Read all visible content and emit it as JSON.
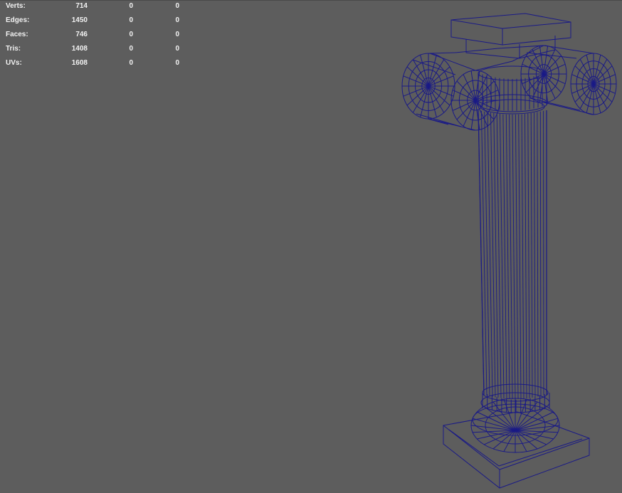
{
  "hud": {
    "rows": [
      {
        "label": "Verts:",
        "values": [
          "714",
          "0",
          "0"
        ]
      },
      {
        "label": "Edges:",
        "values": [
          "1450",
          "0",
          "0"
        ]
      },
      {
        "label": "Faces:",
        "values": [
          "746",
          "0",
          "0"
        ]
      },
      {
        "label": "Tris:",
        "values": [
          "1408",
          "0",
          "0"
        ]
      },
      {
        "label": "UVs:",
        "values": [
          "1608",
          "0",
          "0"
        ]
      }
    ]
  },
  "viewport": {
    "background_color": "#5d5d5d",
    "wireframe_color": "#1a1a86",
    "object": "ionic-column-wireframe-icon"
  }
}
